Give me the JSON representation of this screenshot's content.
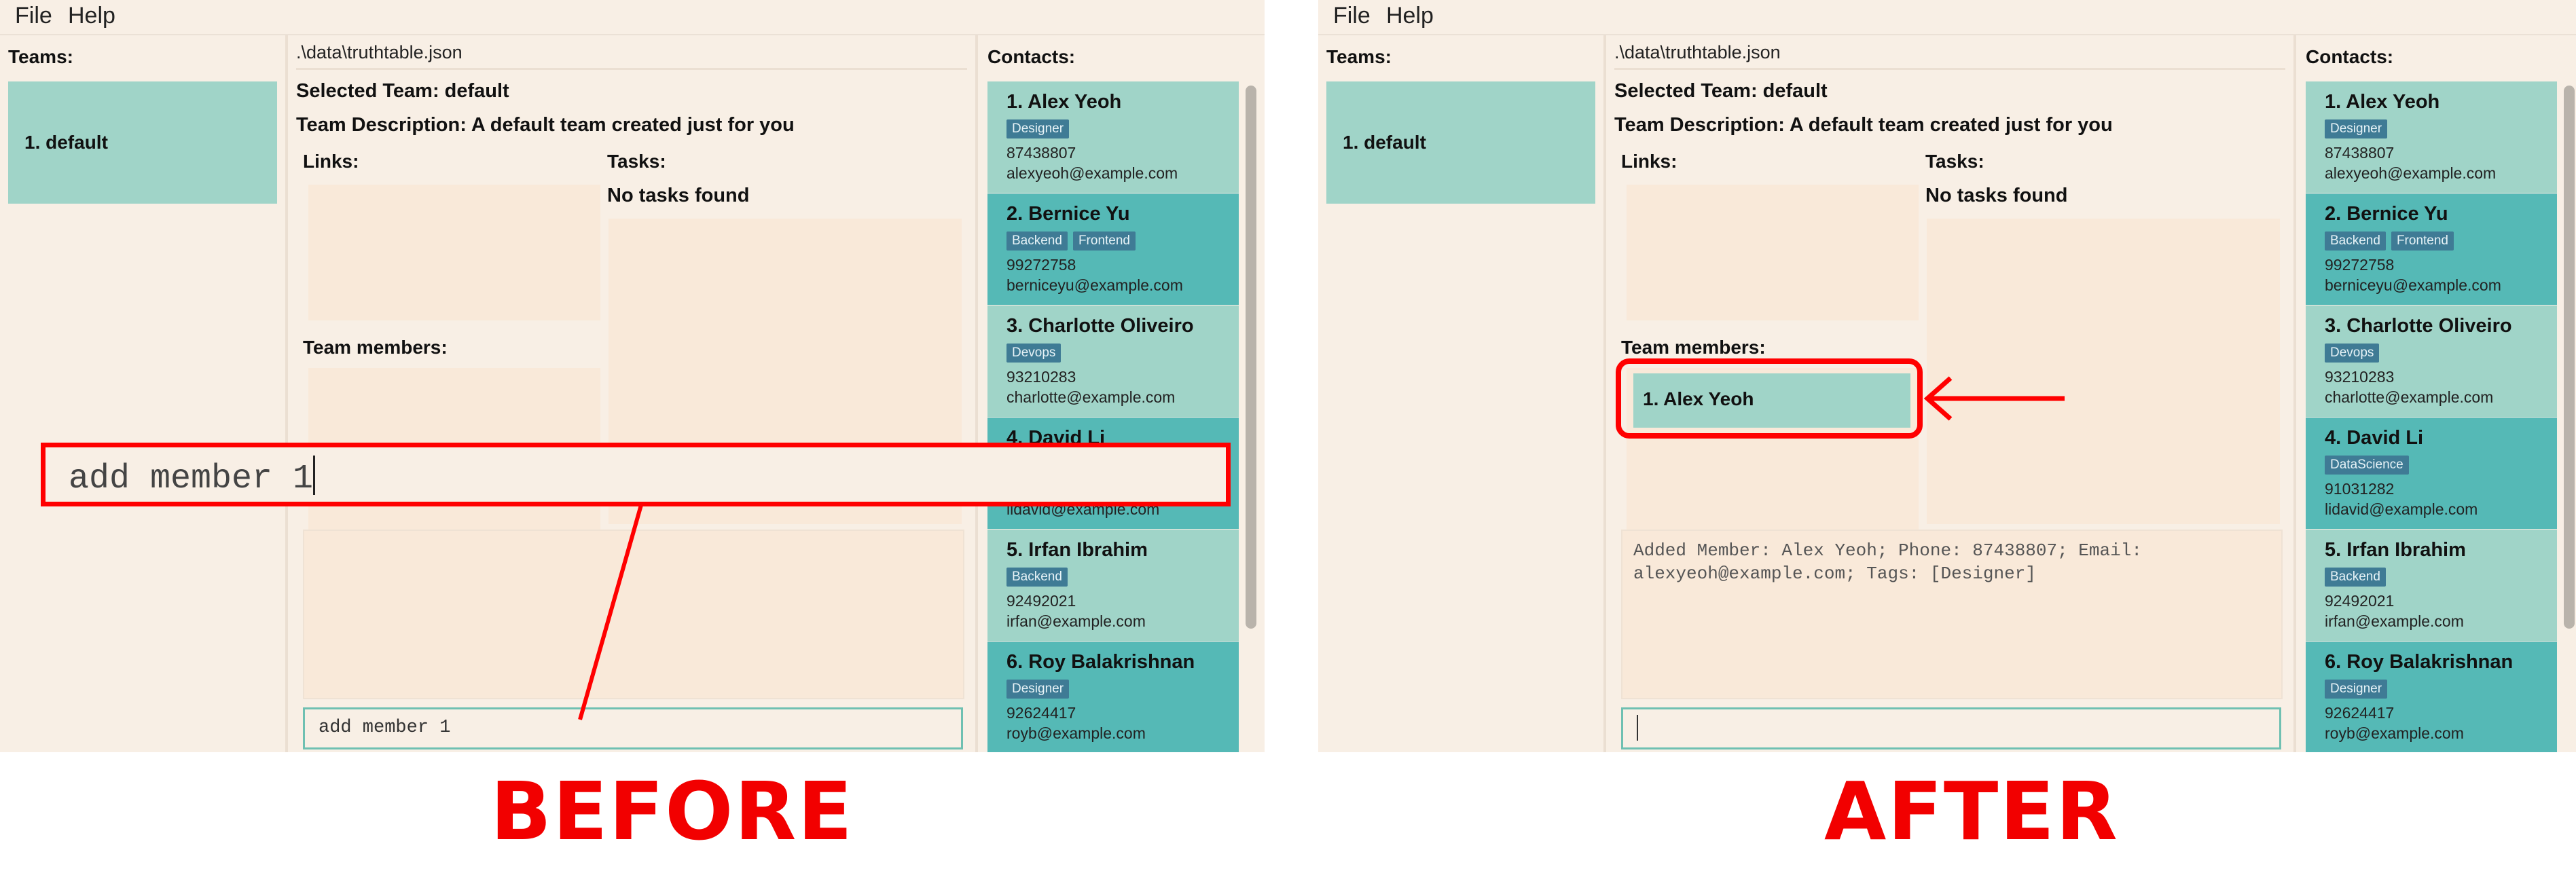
{
  "menu": {
    "file": "File",
    "help": "Help"
  },
  "teams": {
    "title": "Teams:",
    "items": [
      "1. default"
    ]
  },
  "main": {
    "file_path": ".\\data\\truthtable.json",
    "selected_team": "Selected Team: default",
    "team_description": "Team Description: A default team created just for you",
    "links_title": "Links:",
    "tasks_title": "Tasks:",
    "no_tasks": "No tasks found",
    "members_title": "Team members:"
  },
  "contacts": {
    "title": "Contacts:",
    "items": [
      {
        "name": "1. Alex Yeoh",
        "tags": [
          "Designer"
        ],
        "phone": "87438807",
        "email": "alexyeoh@example.com"
      },
      {
        "name": "2. Bernice Yu",
        "tags": [
          "Backend",
          "Frontend"
        ],
        "phone": "99272758",
        "email": "berniceyu@example.com"
      },
      {
        "name": "3. Charlotte Oliveiro",
        "tags": [
          "Devops"
        ],
        "phone": "93210283",
        "email": "charlotte@example.com"
      },
      {
        "name": "4. David Li",
        "tags": [
          "DataScience"
        ],
        "phone": "91031282",
        "email": "lidavid@example.com"
      },
      {
        "name": "5. Irfan Ibrahim",
        "tags": [
          "Backend"
        ],
        "phone": "92492021",
        "email": "irfan@example.com"
      },
      {
        "name": "6. Roy Balakrishnan",
        "tags": [
          "Designer"
        ],
        "phone": "92624417",
        "email": "royb@example.com"
      }
    ]
  },
  "before": {
    "command_value": "add member 1",
    "overlay_command": "add member 1",
    "caption": "BEFORE"
  },
  "after": {
    "member_added": "1. Alex Yeoh",
    "result": "Added Member: Alex Yeoh; Phone: 87438807; Email:\nalexyeoh@example.com; Tags: [Designer]",
    "command_value": "",
    "caption": "AFTER"
  },
  "colors": {
    "background": "#f8efe5",
    "card_light": "#a0d4c8",
    "card_dark": "#55b9b6",
    "tag": "#3f7b95",
    "annotation": "#ff0000"
  }
}
